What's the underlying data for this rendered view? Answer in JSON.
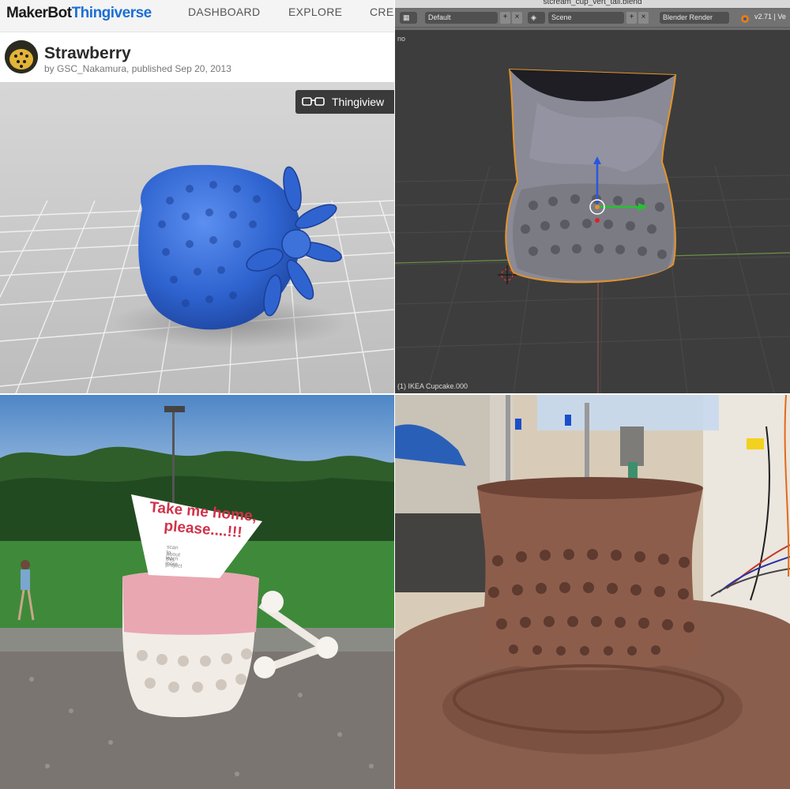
{
  "thingiverse": {
    "logo_maker": "MakerBot",
    "logo_thingiverse": "Thingiverse",
    "nav": [
      "DASHBOARD",
      "EXPLORE",
      "CREA"
    ],
    "title": "Strawberry",
    "byline": "by GSC_Nakamura, published Sep 20, 2013",
    "viewer_button": "Thingiview",
    "colors": {
      "brand": "#1c6fd6",
      "model": "#2f64c6"
    }
  },
  "blender": {
    "window_title": "stcream_cup_vert_tall.blend",
    "layout_field": "Default",
    "scene_field": "Scene",
    "render_engine": "Blender Render",
    "version": "v2.71 | Ve",
    "edge_label": "no",
    "status_object": "(1) IKEA Cupcake.000"
  },
  "photo_outdoor": {
    "sign_line1": "Take me home,",
    "sign_line2": "please....!!!",
    "sign_small1": "scan to learn more",
    "sign_small2": "about this project"
  },
  "photo_printer": {
    "subject": "clay print"
  }
}
